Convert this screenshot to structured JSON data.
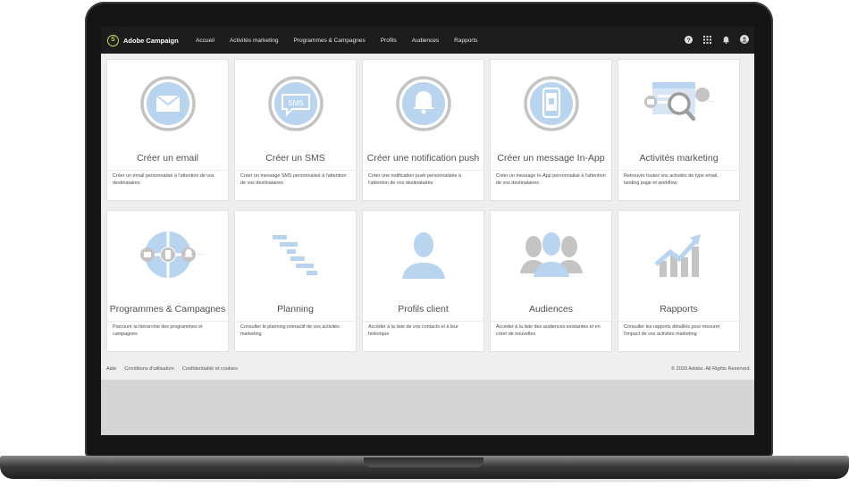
{
  "app": {
    "name": "Adobe Campaign",
    "logo_glyph": "S"
  },
  "nav": [
    {
      "label": "Accueil"
    },
    {
      "label": "Activités marketing"
    },
    {
      "label": "Programmes & Campagnes"
    },
    {
      "label": "Profils"
    },
    {
      "label": "Audiences"
    },
    {
      "label": "Rapports"
    }
  ],
  "toolbar_icons": [
    "help-icon",
    "apps-grid-icon",
    "bell-icon",
    "user-avatar-icon"
  ],
  "cards": [
    {
      "title": "Créer un email",
      "description": "Créer un email personnalisé à l'attention de vos destinataires",
      "icon": "email-icon"
    },
    {
      "title": "Créer un SMS",
      "description": "Créer un message SMS personnalisé à l'attention de vos destinataires",
      "icon": "sms-icon",
      "icon_text": "SMS"
    },
    {
      "title": "Créer une notification push",
      "description": "Créer une notification push personnalisée à l'attention de vos destinataires",
      "icon": "bell-icon"
    },
    {
      "title": "Créer un message In-App",
      "description": "Créer un message In-App personnalisé à l'attention de vos destinataires",
      "icon": "mobile-icon"
    },
    {
      "title": "Activités marketing",
      "description": "Retrouver toutes vos activités de type email, landing page et workflow",
      "icon": "marketing-search-icon"
    },
    {
      "title": "Programmes & Campagnes",
      "description": "Parcourir la hiérarchie des programmes et campagnes",
      "icon": "programs-wheel-icon"
    },
    {
      "title": "Planning",
      "description": "Consulter le planning interactif de vos activités marketing",
      "icon": "gantt-icon"
    },
    {
      "title": "Profils client",
      "description": "Accéder à la liste de vos contacts et à leur historique",
      "icon": "person-icon"
    },
    {
      "title": "Audiences",
      "description": "Accéder à la liste des audiences existantes et en créer de nouvelles",
      "icon": "group-icon"
    },
    {
      "title": "Rapports",
      "description": "Consulter les rapports détaillés pour mesurer l'impact de vos activités marketing",
      "icon": "bar-chart-icon"
    }
  ],
  "footer": {
    "links": [
      {
        "label": "Aide"
      },
      {
        "label": "Conditions d'utilisation"
      },
      {
        "label": "Confidentialité et cookies"
      }
    ],
    "copyright": "© 2020 Adobe. All Rights Reserved."
  },
  "colors": {
    "accent": "#b8d4ef",
    "ring": "#c4c4c4",
    "topbar": "#1c1c1c",
    "logo": "#c7d94a",
    "chart_arrow": "#b8d4ef"
  }
}
